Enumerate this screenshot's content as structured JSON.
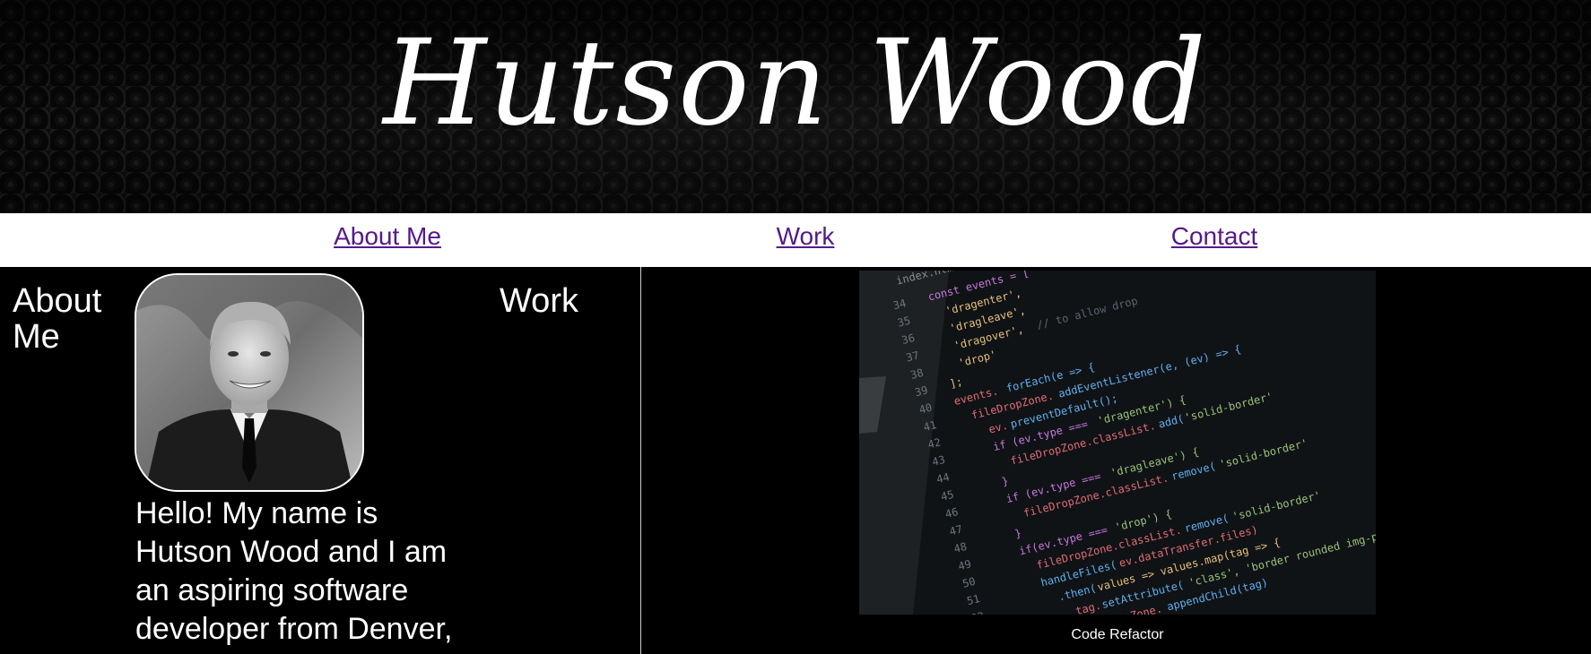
{
  "header": {
    "title": "Hutson Wood"
  },
  "nav": {
    "items": [
      {
        "label": "About Me"
      },
      {
        "label": "Work"
      },
      {
        "label": "Contact"
      }
    ]
  },
  "about": {
    "heading": "About Me",
    "bio": "Hello! My name is Hutson Wood and I am an aspiring software developer from Denver,"
  },
  "work": {
    "heading": "Work",
    "projects": [
      {
        "caption": "Code Refactor"
      }
    ]
  },
  "colors": {
    "background": "#000000",
    "nav_background": "#ffffff",
    "link": "#551a8b",
    "text": "#ffffff"
  }
}
